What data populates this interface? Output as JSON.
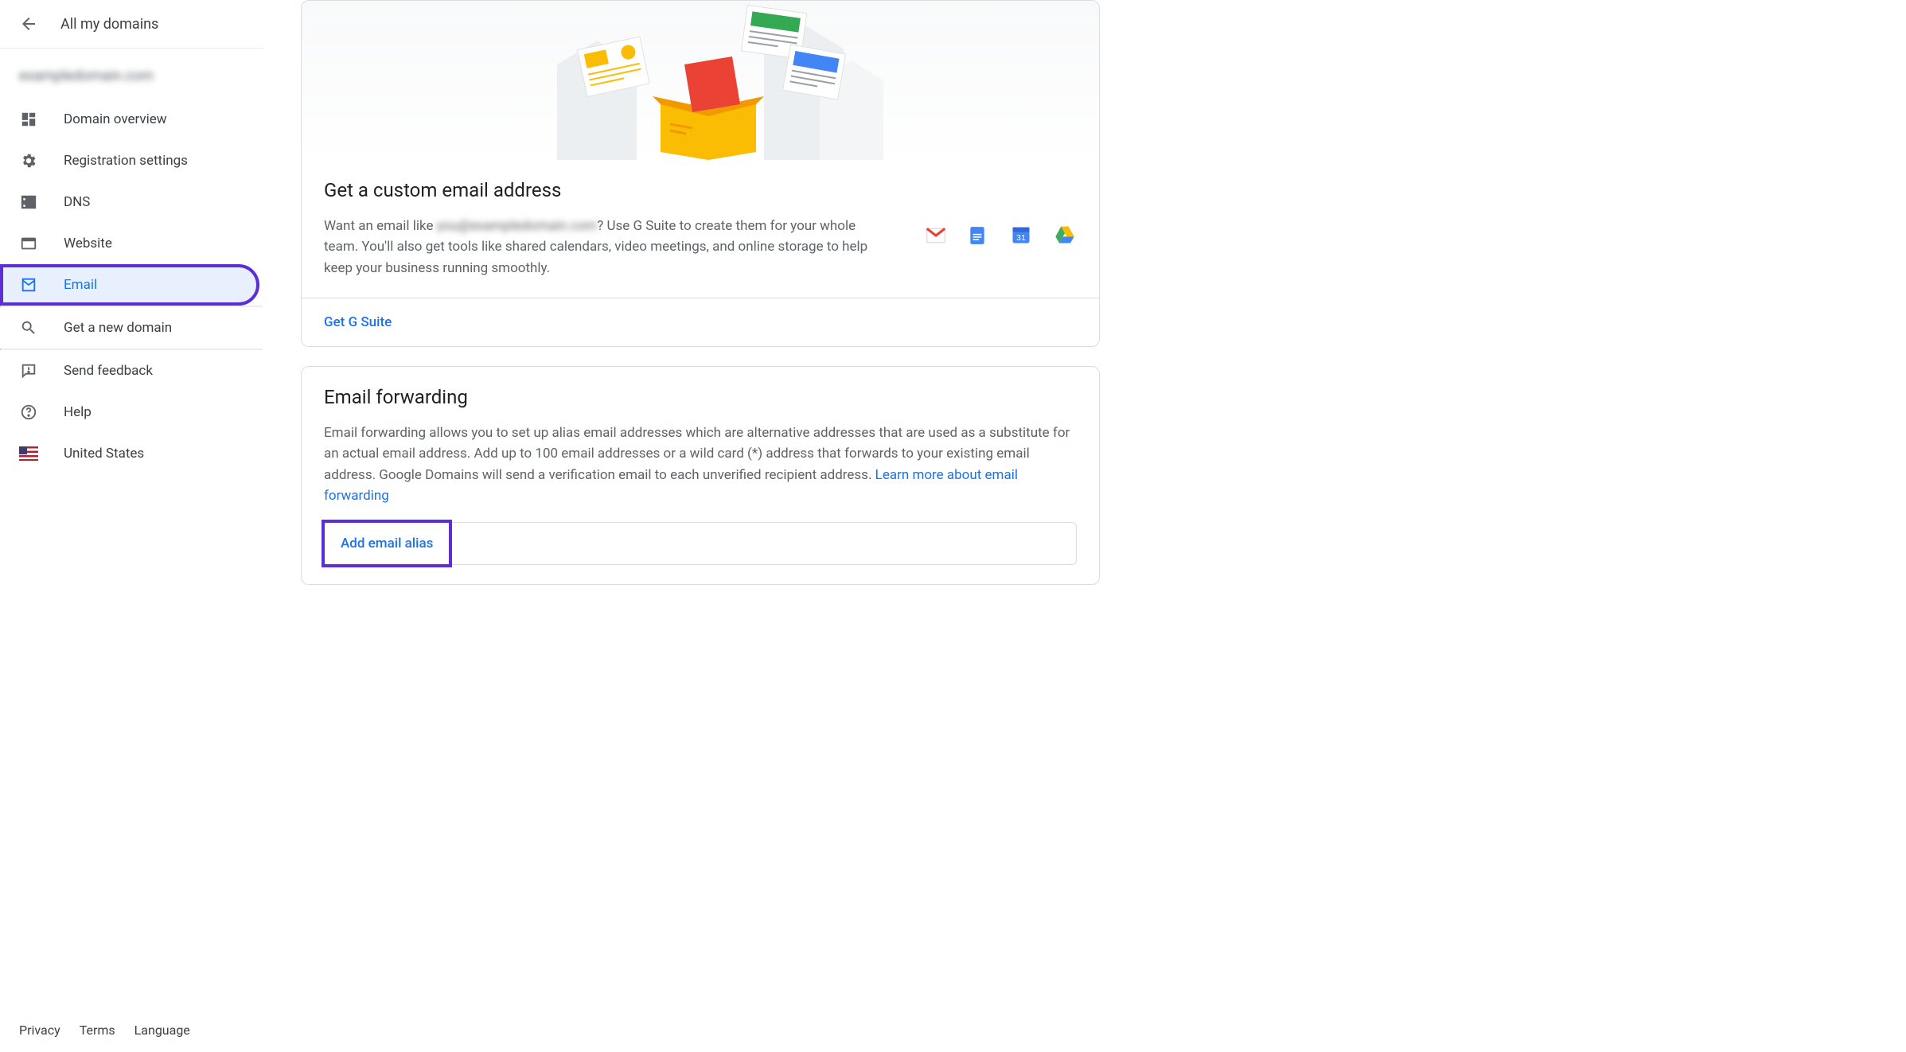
{
  "sidebar": {
    "back_title": "All my domains",
    "domain_name": "exampledomain.com",
    "nav": [
      {
        "label": "Domain overview",
        "icon": "dashboard-icon"
      },
      {
        "label": "Registration settings",
        "icon": "gear-icon"
      },
      {
        "label": "DNS",
        "icon": "dns-icon"
      },
      {
        "label": "Website",
        "icon": "website-icon"
      },
      {
        "label": "Email",
        "icon": "email-icon",
        "active": true
      }
    ],
    "search_label": "Get a new domain",
    "feedback_label": "Send feedback",
    "help_label": "Help",
    "region_label": "United States",
    "footer": {
      "privacy": "Privacy",
      "terms": "Terms",
      "language": "Language"
    }
  },
  "main": {
    "gsuite": {
      "title": "Get a custom email address",
      "text_before": "Want an email like ",
      "blurred": "you@exampledomain.com",
      "text_after": "? Use G Suite to create them for your whole team. You'll also get tools like shared calendars, video meetings, and online storage to help keep your business running smoothly.",
      "cta": "Get G Suite"
    },
    "forwarding": {
      "title": "Email forwarding",
      "body": "Email forwarding allows you to set up alias email addresses which are alternative addresses that are used as a substitute for an actual email address. Add up to 100 email addresses or a wild card (*) address that forwards to your existing email address. Google Domains will send a verification email to each unverified recipient address. ",
      "learn_more": "Learn more about email forwarding",
      "add_alias": "Add email alias"
    }
  }
}
